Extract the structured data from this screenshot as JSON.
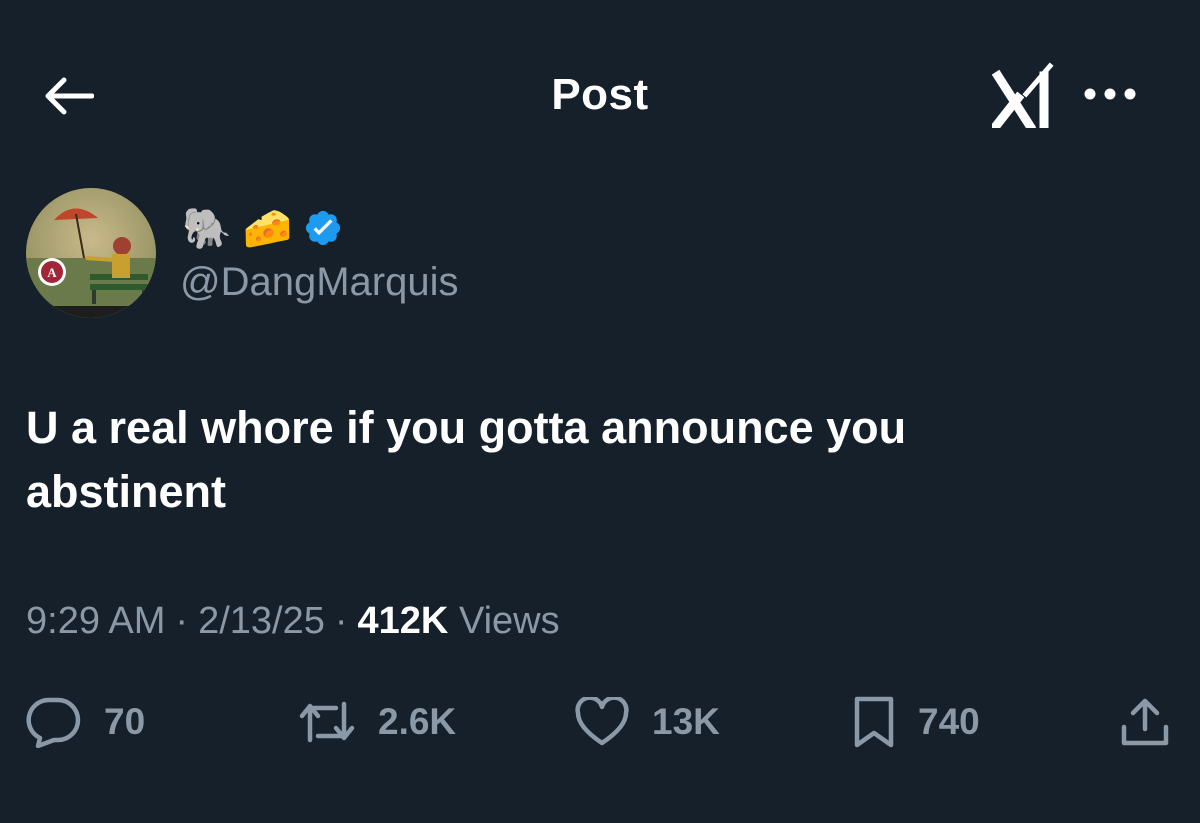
{
  "header": {
    "title": "Post",
    "back_icon": "arrow-left-icon",
    "grok_icon": "grok-icon",
    "more_icon": "ellipsis-icon"
  },
  "author": {
    "display_name": "🐘 🧀",
    "handle": "@DangMarquis",
    "verified": true,
    "verified_color": "#1d9bf0"
  },
  "tweet": {
    "text": "U a real whore if you gotta announce you\nabstinent",
    "time": "9:29 AM",
    "date": "2/13/25",
    "views_count": "412K",
    "views_label": "Views"
  },
  "actions": {
    "replies": "70",
    "reposts": "2.6K",
    "likes": "13K",
    "bookmarks": "740"
  },
  "colors": {
    "background": "#15202b",
    "text_primary": "#ffffff",
    "text_secondary": "#8b98a5",
    "accent": "#1d9bf0"
  }
}
